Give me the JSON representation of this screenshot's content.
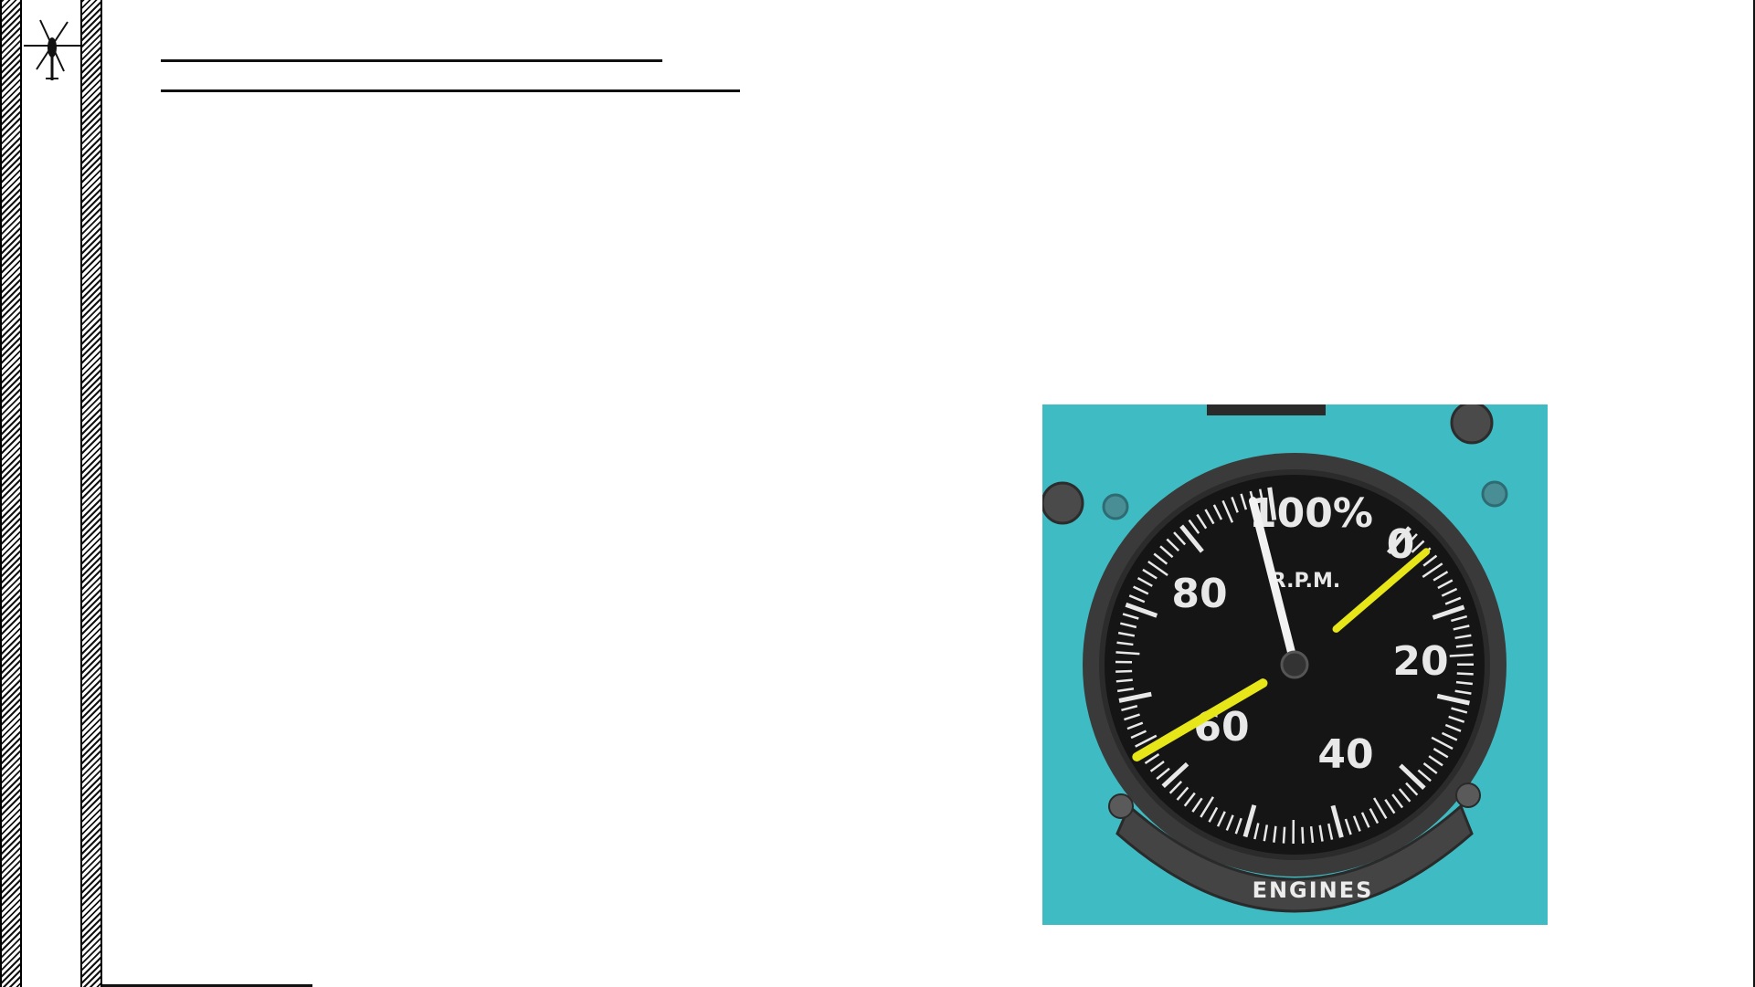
{
  "gauge": {
    "percent_label": "100%",
    "rpm_label": "R.P.M.",
    "dial_labels": [
      "0",
      "20",
      "40",
      "60",
      "80"
    ],
    "bezel_label": "ENGINES",
    "white_needle_percent": 98,
    "yellow_needle_percent": 3,
    "yellow_marker_percent": 64
  },
  "colors": {
    "panel": "#3fbcc3",
    "dial": "#151515",
    "marker": "#e6e619",
    "bezel": "#3a3a3a"
  }
}
